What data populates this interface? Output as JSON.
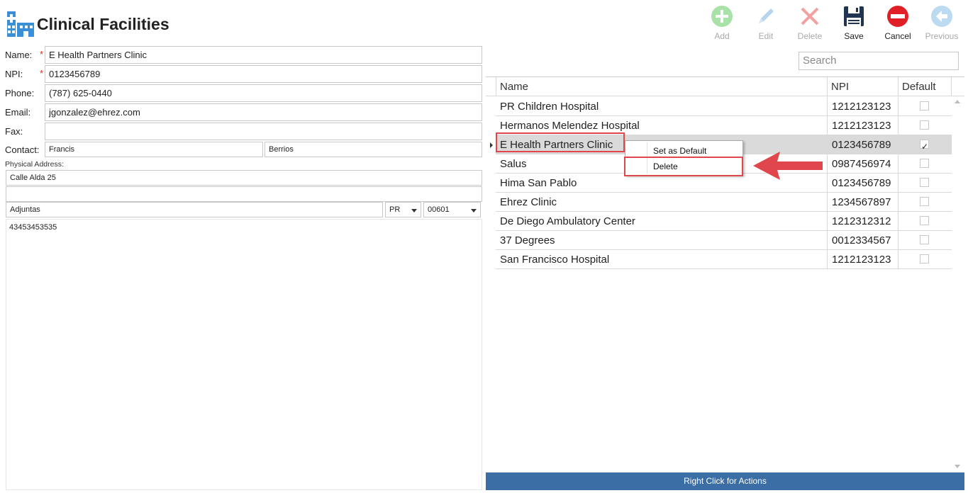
{
  "header": {
    "title": "Clinical Facilities"
  },
  "toolbar": {
    "add": "Add",
    "edit": "Edit",
    "delete": "Delete",
    "save": "Save",
    "cancel": "Cancel",
    "previous": "Previous"
  },
  "form": {
    "name_label": "Name:",
    "name_value": "E Health Partners Clinic",
    "npi_label": "NPI:",
    "npi_value": "0123456789",
    "phone_label": "Phone:",
    "phone_value": "(787) 625-0440",
    "email_label": "Email:",
    "email_value": "jgonzalez@ehrez.com",
    "fax_label": "Fax:",
    "fax_value": "",
    "contact_label": "Contact:",
    "contact_first": "Francis",
    "contact_last": "Berrios",
    "physical_address_label": "Physical Address:",
    "address_line1": "Calle Alda 25",
    "address_line2": "",
    "city": "Adjuntas",
    "state": "PR",
    "zip": "00601",
    "notes": "43453453535",
    "required_mark": "*"
  },
  "search": {
    "placeholder": "Search"
  },
  "grid": {
    "columns": [
      "Name",
      "NPI",
      "Default"
    ],
    "rows": [
      {
        "name": "PR Children Hospital",
        "npi": "1212123123",
        "default": false
      },
      {
        "name": "Hermanos Melendez Hospital",
        "npi": "1212123123",
        "default": false
      },
      {
        "name": "E Health Partners Clinic",
        "npi": "0123456789",
        "default": true
      },
      {
        "name": "Salus",
        "npi": "0987456974",
        "default": false
      },
      {
        "name": "Hima San Pablo",
        "npi": "0123456789",
        "default": false
      },
      {
        "name": "Ehrez  Clinic",
        "npi": "1234567897",
        "default": false
      },
      {
        "name": "De Diego Ambulatory Center",
        "npi": "1212312312",
        "default": false
      },
      {
        "name": "37 Degrees",
        "npi": "0012334567",
        "default": false
      },
      {
        "name": "San Francisco Hospital",
        "npi": "1212123123",
        "default": false
      }
    ]
  },
  "context_menu": {
    "set_default": "Set as Default",
    "delete": "Delete"
  },
  "status_bar": {
    "text": "Right Click for Actions"
  },
  "colors": {
    "accent": "#3b6ea5",
    "highlight": "#e0474c",
    "cancel_red": "#e02026",
    "add_green": "#7fd07f"
  }
}
